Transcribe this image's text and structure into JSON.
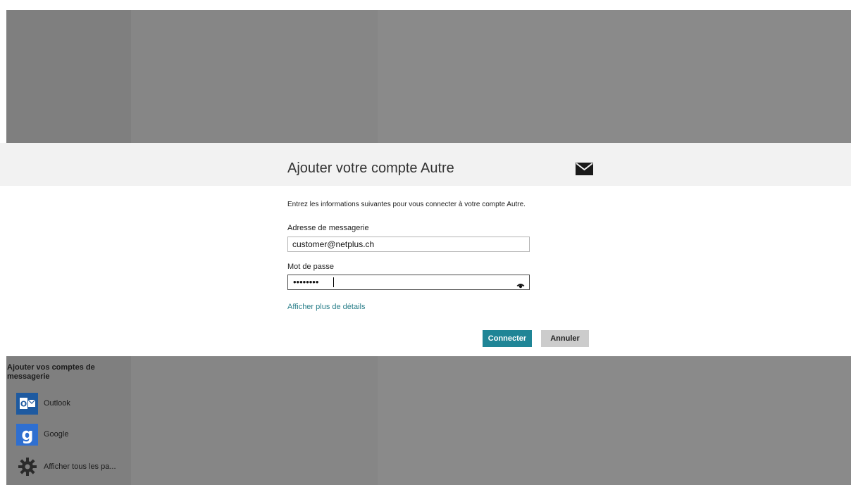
{
  "dialog": {
    "title": "Ajouter votre compte Autre",
    "intro": "Entrez les informations suivantes pour vous connecter à votre compte Autre.",
    "email_label": "Adresse de messagerie",
    "email_value": "customer@netplus.ch",
    "password_label": "Mot de passe",
    "password_value": "••••••••",
    "details_link": "Afficher plus de détails",
    "connect_label": "Connecter",
    "cancel_label": "Annuler",
    "icons": {
      "header": "mail-icon",
      "password_reveal": "eye-icon"
    }
  },
  "accounts_panel": {
    "title": "Ajouter vos comptes de messagerie",
    "items": [
      {
        "label": "Outlook",
        "icon": "outlook-icon"
      },
      {
        "label": "Google",
        "icon": "google-icon"
      },
      {
        "label": "Afficher tous les pa...",
        "icon": "gear-icon"
      }
    ]
  },
  "colors": {
    "accent": "#1f8596",
    "link": "#2a7f8a",
    "overlay": "#8a8a8a"
  }
}
